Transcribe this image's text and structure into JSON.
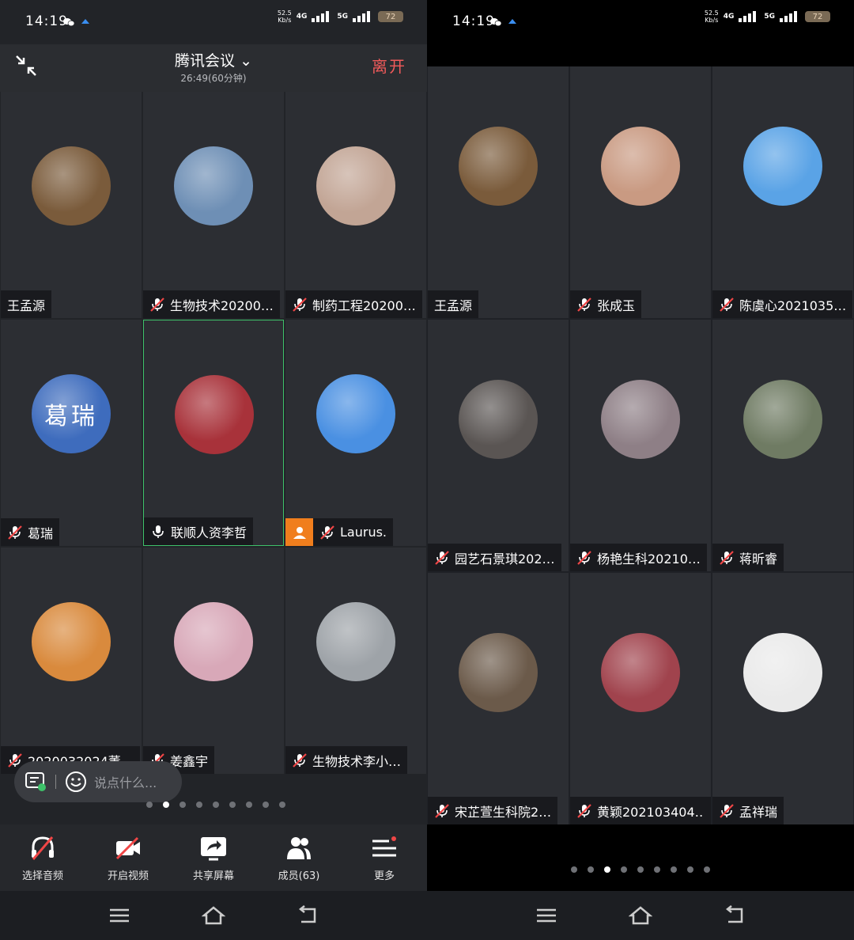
{
  "status": {
    "time": "14:19",
    "speed_value": "52.5",
    "speed_unit": "Kb/s",
    "net1": "4G",
    "net2": "5G",
    "battery": "72"
  },
  "header": {
    "title": "腾讯会议",
    "subtitle": "26:49(60分钟)",
    "leave_label": "离开"
  },
  "left_page": [
    {
      "name": "王孟源",
      "mic": "none",
      "avatar_color": "#7a5b3b"
    },
    {
      "name": "生物技术20200…",
      "mic": "muted",
      "avatar_color": "#6e8fb5"
    },
    {
      "name": "制药工程20200…",
      "mic": "muted",
      "avatar_color": "#c2a595"
    },
    {
      "name": "葛瑞",
      "mic": "muted",
      "avatar_color": "#3e6cbd",
      "avatar_text": "葛瑞"
    },
    {
      "name": "联顺人资李哲",
      "mic": "on",
      "avatar_color": "#a8323a",
      "active": true
    },
    {
      "name": "Laurus.",
      "mic": "muted",
      "avatar_color": "#4a90e2",
      "host": true
    },
    {
      "name": "2020032024董…",
      "mic": "muted",
      "avatar_color": "#d98a3d"
    },
    {
      "name": "姜鑫宇",
      "mic": "muted",
      "avatar_color": "#d8a8b8"
    },
    {
      "name": "生物技术李小…",
      "mic": "muted",
      "avatar_color": "#9ea3a8"
    }
  ],
  "right_page": [
    {
      "name": "王孟源",
      "mic": "none",
      "avatar_color": "#7a5b3b"
    },
    {
      "name": "张成玉",
      "mic": "muted",
      "avatar_color": "#c99a82"
    },
    {
      "name": "陈虞心2021035…",
      "mic": "muted",
      "avatar_color": "#5aa3e6"
    },
    {
      "name": "园艺石景琪202…",
      "mic": "muted",
      "avatar_color": "#5a5553"
    },
    {
      "name": "杨艳生科20210…",
      "mic": "muted",
      "avatar_color": "#8e7f86"
    },
    {
      "name": "蒋昕睿",
      "mic": "muted",
      "avatar_color": "#6f7b63"
    },
    {
      "name": "宋芷萱生科院2…",
      "mic": "muted",
      "avatar_color": "#6b5a4a"
    },
    {
      "name": "黄颖202103404…",
      "mic": "muted",
      "avatar_color": "#a0434d"
    },
    {
      "name": "孟祥瑞",
      "mic": "muted",
      "avatar_color": "#eaeaea"
    }
  ],
  "chat": {
    "placeholder": "说点什么..."
  },
  "pagination_left": {
    "count": 9,
    "active": 1
  },
  "pagination_right": {
    "count": 9,
    "active": 2
  },
  "toolbar": [
    {
      "label": "选择音频",
      "icon": "audio-off-icon"
    },
    {
      "label": "开启视频",
      "icon": "video-off-icon"
    },
    {
      "label": "共享屏幕",
      "icon": "share-screen-icon"
    },
    {
      "label": "成员(63)",
      "icon": "members-icon"
    },
    {
      "label": "更多",
      "icon": "more-icon"
    }
  ]
}
